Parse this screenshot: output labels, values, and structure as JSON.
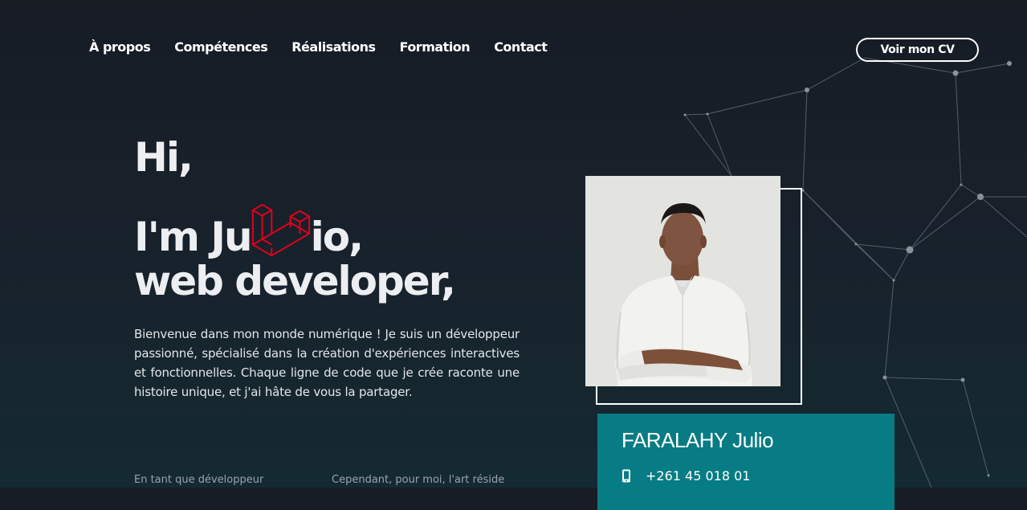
{
  "nav": {
    "items": [
      {
        "label": "À propos"
      },
      {
        "label": "Compétences"
      },
      {
        "label": "Réalisations"
      },
      {
        "label": "Formation"
      },
      {
        "label": "Contact"
      }
    ],
    "cv_button": "Voir mon CV"
  },
  "hero": {
    "line1": "Hi,",
    "line2_before": "I'm Ju",
    "line2_after": "io,",
    "line3": "web developer,",
    "logo_icon": "laravel-icon"
  },
  "intro": "Bienvenue dans mon monde numérique ! Je suis un développeur passionné, spécialisé dans la création d'expériences interactives et fonctionnelles. Chaque ligne de code que je crée raconte une histoire unique, et j'ai hâte de vous la partager.",
  "columns": [
    {
      "text": "En tant que développeur"
    },
    {
      "text": "Cependant, pour moi, l'art réside"
    }
  ],
  "profile": {
    "name": "FARALAHY Julio",
    "phone": "+261 45 018 01",
    "phone_icon": "phone-icon"
  },
  "colors": {
    "accent": "#087c84",
    "logo": "#e3001b",
    "background": "#171c25"
  }
}
